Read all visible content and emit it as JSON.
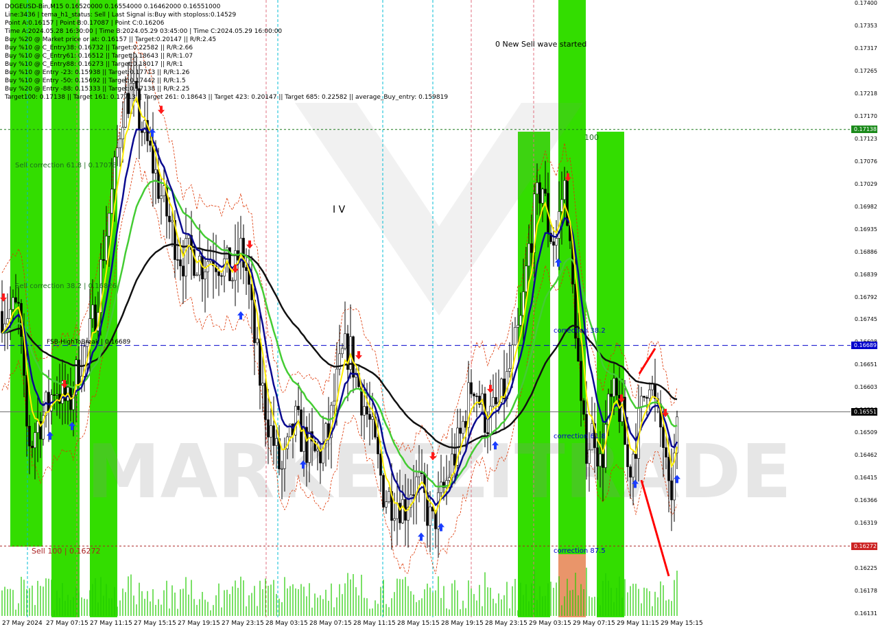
{
  "header": {
    "lines": [
      "DOGEUSD-Bin,M15  0.16520000 0.16554000 0.16462000 0.16551000",
      "Line:3436 | tema_h1_status: Sell | Last Signal is:Buy with stoploss:0.14529",
      "Point A:0.16157 | Point B:0.17087 | Point C:0.16206",
      "Time A:2024.05.28 16:30:00 | Time B:2024.05.29 03:45:00 | Time C:2024.05.29 16:00:00",
      "Buy %20 @ Market price or at: 0.16157 || Target:0.20147 || R/R:2.45",
      "Buy %10 @ C_Entry38: 0.16732 || Target:0.22582 || R/R:2.66",
      "Buy %10 @ C_Entry61: 0.16512 || Target:0.18643 || R/R:1.07",
      "Buy %10 @ C_Entry88: 0.16273 || Target:0.18017 || R/R:1",
      "Buy %10 @ Entry -23: 0.15938 || Target:0.17713 || R/R:1.26",
      "Buy %10 @ Entry -50: 0.15692 || Target:0.17442 || R/R:1.5",
      "Buy %20 @ Entry -88: 0.15333 || Target:0.17138 || R/R:2.25",
      "Target100: 0.17138 || Target 161: 0.17713 || Target 261: 0.18643 || Target 423: 0.20147 || Target 685: 0.22582 || average_Buy_entry: 0.159819"
    ]
  },
  "labels": {
    "wave": "0 New Sell wave started",
    "roman": "I V",
    "sell_corr_618": "Sell correction 61.8 | 0.17078",
    "sell_corr_382": "Sell correction 38.2 | 0.16826",
    "fsb": "FSB-HighToBreak | 0.16689",
    "sell_100": "Sell 100 | 0.16272",
    "corr_382": "correction 38.2",
    "corr_618": "correction 61.8",
    "corr_875": "correction 87.5",
    "hundred": "100",
    "watermark": "MARKETZITRADE"
  },
  "price_axis": {
    "ticks": [
      "0.17400",
      "0.17353",
      "0.17317",
      "0.17265",
      "0.17218",
      "0.17170",
      "0.17123",
      "0.17076",
      "0.17029",
      "0.16982",
      "0.16935",
      "0.16886",
      "0.16839",
      "0.16792",
      "0.16745",
      "0.16698",
      "0.16651",
      "0.16603",
      "0.16556",
      "0.16509",
      "0.16462",
      "0.16415",
      "0.16366",
      "0.16319",
      "0.16272",
      "0.16225",
      "0.16178",
      "0.16131"
    ],
    "badges": [
      {
        "text": "0.17138",
        "kind": "green"
      },
      {
        "text": "0.16689",
        "kind": "blue"
      },
      {
        "text": "0.16551",
        "kind": "black"
      },
      {
        "text": "0.16272",
        "kind": "red"
      }
    ]
  },
  "time_axis": {
    "ticks": [
      "27 May 2024",
      "27 May 07:15",
      "27 May 11:15",
      "27 May 15:15",
      "27 May 19:15",
      "27 May 23:15",
      "28 May 03:15",
      "28 May 07:15",
      "28 May 11:15",
      "28 May 15:15",
      "28 May 19:15",
      "28 May 23:15",
      "29 May 03:15",
      "29 May 07:15",
      "29 May 11:15",
      "29 May 15:15"
    ]
  },
  "colors": {
    "zone_green": "#33dd00",
    "zone_orange": "#e9956a",
    "ma_black": "#111111",
    "ma_green": "#44cc33",
    "ma_navy": "#0a0a90",
    "ma_yellow": "#ffee00",
    "env_red": "#dd3300",
    "level_green": "#1b7a1b",
    "level_blue": "#0000cc",
    "level_red": "#aa2222"
  },
  "chart_data": {
    "type": "candlestick",
    "symbol": "DOGEUSD-Bin",
    "timeframe": "M15",
    "ohlc_last": {
      "open": 0.1652,
      "high": 0.16554,
      "low": 0.16462,
      "close": 0.16551
    },
    "ylim": [
      0.1612,
      0.1741
    ],
    "levels": [
      {
        "name": "Target100",
        "value": 0.17138
      },
      {
        "name": "FSB-HighToBreak",
        "value": 0.16689
      },
      {
        "name": "Sell 100",
        "value": 0.16272
      },
      {
        "name": "Current",
        "value": 0.16551
      }
    ],
    "close_path": [
      [
        27,
        0.1676
      ],
      [
        31,
        0.1668
      ],
      [
        38,
        0.1652
      ],
      [
        45,
        0.1648
      ],
      [
        52,
        0.1652
      ],
      [
        62,
        0.1654
      ],
      [
        72,
        0.1657
      ],
      [
        80,
        0.1661
      ],
      [
        88,
        0.1659
      ],
      [
        100,
        0.1656
      ],
      [
        110,
        0.1662
      ],
      [
        118,
        0.1666
      ],
      [
        128,
        0.1669
      ],
      [
        140,
        0.1677
      ],
      [
        152,
        0.169
      ],
      [
        165,
        0.1702
      ],
      [
        178,
        0.1718
      ],
      [
        192,
        0.1722
      ],
      [
        205,
        0.1715
      ],
      [
        220,
        0.1708
      ],
      [
        235,
        0.17
      ],
      [
        250,
        0.1693
      ],
      [
        265,
        0.1687
      ],
      [
        280,
        0.1688
      ],
      [
        295,
        0.1686
      ],
      [
        310,
        0.1688
      ],
      [
        325,
        0.1686
      ],
      [
        340,
        0.1683
      ],
      [
        350,
        0.1689
      ],
      [
        360,
        0.1684
      ],
      [
        370,
        0.1671
      ],
      [
        380,
        0.1661
      ],
      [
        390,
        0.1654
      ],
      [
        400,
        0.1648
      ],
      [
        410,
        0.1642
      ],
      [
        420,
        0.1647
      ],
      [
        430,
        0.1653
      ],
      [
        440,
        0.165
      ],
      [
        450,
        0.1647
      ],
      [
        460,
        0.1646
      ],
      [
        470,
        0.1647
      ],
      [
        480,
        0.1651
      ],
      [
        490,
        0.166
      ],
      [
        500,
        0.1667
      ],
      [
        510,
        0.1668
      ],
      [
        520,
        0.1662
      ],
      [
        530,
        0.1657
      ],
      [
        540,
        0.1652
      ],
      [
        550,
        0.1645
      ],
      [
        560,
        0.1638
      ],
      [
        570,
        0.1637
      ],
      [
        580,
        0.1637
      ],
      [
        590,
        0.1635
      ],
      [
        600,
        0.164
      ],
      [
        610,
        0.164
      ],
      [
        620,
        0.1636
      ],
      [
        630,
        0.1631
      ],
      [
        640,
        0.1636
      ],
      [
        650,
        0.164
      ],
      [
        660,
        0.1645
      ],
      [
        670,
        0.1649
      ],
      [
        680,
        0.1656
      ],
      [
        690,
        0.1662
      ],
      [
        700,
        0.1657
      ],
      [
        710,
        0.1653
      ],
      [
        720,
        0.1655
      ],
      [
        730,
        0.1657
      ],
      [
        740,
        0.1662
      ],
      [
        750,
        0.1668
      ],
      [
        760,
        0.1674
      ],
      [
        770,
        0.1688
      ],
      [
        780,
        0.1697
      ],
      [
        790,
        0.1703
      ],
      [
        800,
        0.1693
      ],
      [
        810,
        0.169
      ],
      [
        818,
        0.1699
      ],
      [
        825,
        0.1703
      ],
      [
        832,
        0.1685
      ],
      [
        840,
        0.1672
      ],
      [
        848,
        0.1652
      ],
      [
        856,
        0.1648
      ],
      [
        866,
        0.1652
      ],
      [
        876,
        0.1643
      ],
      [
        886,
        0.1655
      ],
      [
        896,
        0.1658
      ],
      [
        906,
        0.1655
      ],
      [
        916,
        0.1642
      ],
      [
        926,
        0.1649
      ],
      [
        936,
        0.1656
      ],
      [
        946,
        0.1664
      ],
      [
        956,
        0.1655
      ],
      [
        966,
        0.165
      ],
      [
        976,
        0.1635
      ],
      [
        984,
        0.1646
      ],
      [
        990,
        0.1655
      ]
    ]
  }
}
